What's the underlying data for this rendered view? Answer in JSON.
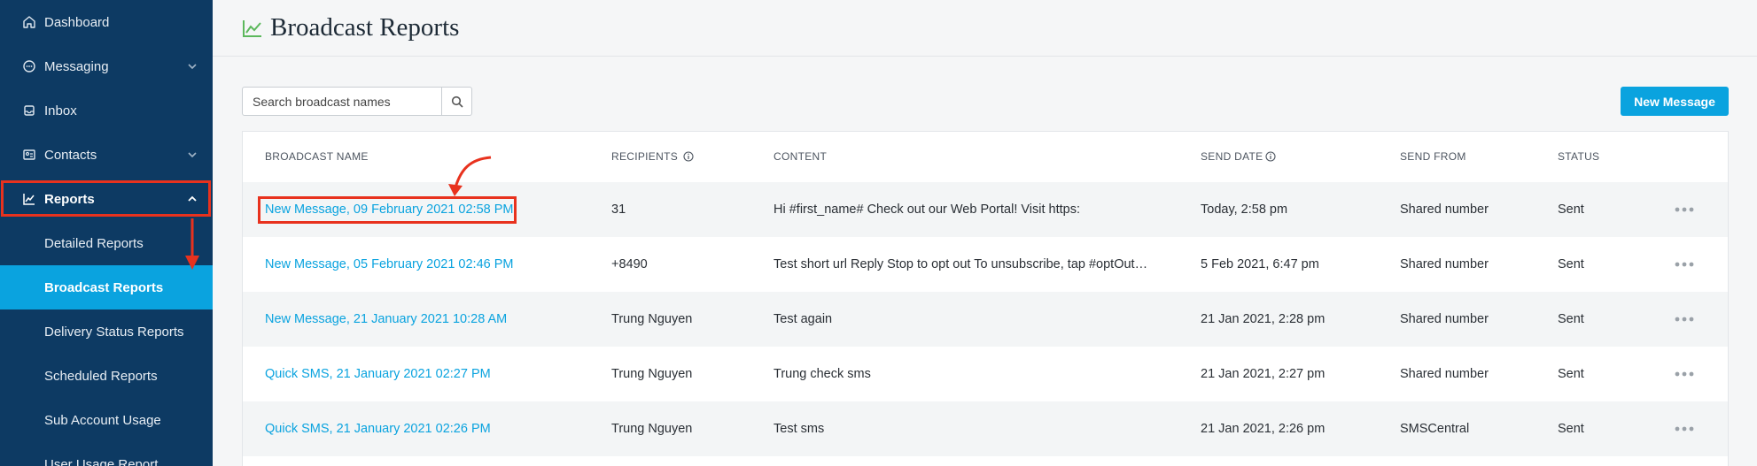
{
  "sidebar": {
    "items": [
      {
        "label": "Dashboard"
      },
      {
        "label": "Messaging"
      },
      {
        "label": "Inbox"
      },
      {
        "label": "Contacts"
      },
      {
        "label": "Reports"
      }
    ],
    "sub_items": [
      {
        "label": "Detailed Reports"
      },
      {
        "label": "Broadcast Reports"
      },
      {
        "label": "Delivery Status Reports"
      },
      {
        "label": "Scheduled Reports"
      },
      {
        "label": "Sub Account Usage"
      },
      {
        "label": "User Usage Report"
      }
    ]
  },
  "header": {
    "title": "Broadcast Reports"
  },
  "search": {
    "placeholder": "Search broadcast names"
  },
  "toolbar": {
    "new_message_label": "New Message"
  },
  "table": {
    "headers": {
      "name": "BROADCAST NAME",
      "recipients": "RECIPIENTS",
      "content": "CONTENT",
      "send_date": "SEND DATE",
      "send_from": "SEND FROM",
      "status": "STATUS"
    },
    "rows": [
      {
        "name": "New Message, 09 February 2021 02:58 PM",
        "recipients": "31",
        "content": "Hi #first_name# Check out our Web Portal! Visit https:",
        "send_date": "Today, 2:58 pm",
        "send_from": "Shared number",
        "status": "Sent"
      },
      {
        "name": "New Message, 05 February 2021 02:46 PM",
        "recipients": "+8490",
        "content": "Test short url Reply Stop to opt out To unsubscribe, tap #optOutLink#",
        "send_date": "5 Feb 2021, 6:47 pm",
        "send_from": "Shared number",
        "status": "Sent"
      },
      {
        "name": "New Message, 21 January 2021 10:28 AM",
        "recipients": "Trung Nguyen",
        "content": "Test again",
        "send_date": "21 Jan 2021, 2:28 pm",
        "send_from": "Shared number",
        "status": "Sent"
      },
      {
        "name": "Quick SMS, 21 January 2021 02:27 PM",
        "recipients": "Trung Nguyen",
        "content": "Trung check sms",
        "send_date": "21 Jan 2021, 2:27 pm",
        "send_from": "Shared number",
        "status": "Sent"
      },
      {
        "name": "Quick SMS, 21 January 2021 02:26 PM",
        "recipients": "Trung Nguyen",
        "content": "Test sms",
        "send_date": "21 Jan 2021, 2:26 pm",
        "send_from": "SMSCentral",
        "status": "Sent"
      }
    ]
  },
  "colors": {
    "sidebar_bg": "#0d3a63",
    "accent": "#0aa3df",
    "annotation": "#e8321e",
    "title_icon": "#5cb85c"
  }
}
